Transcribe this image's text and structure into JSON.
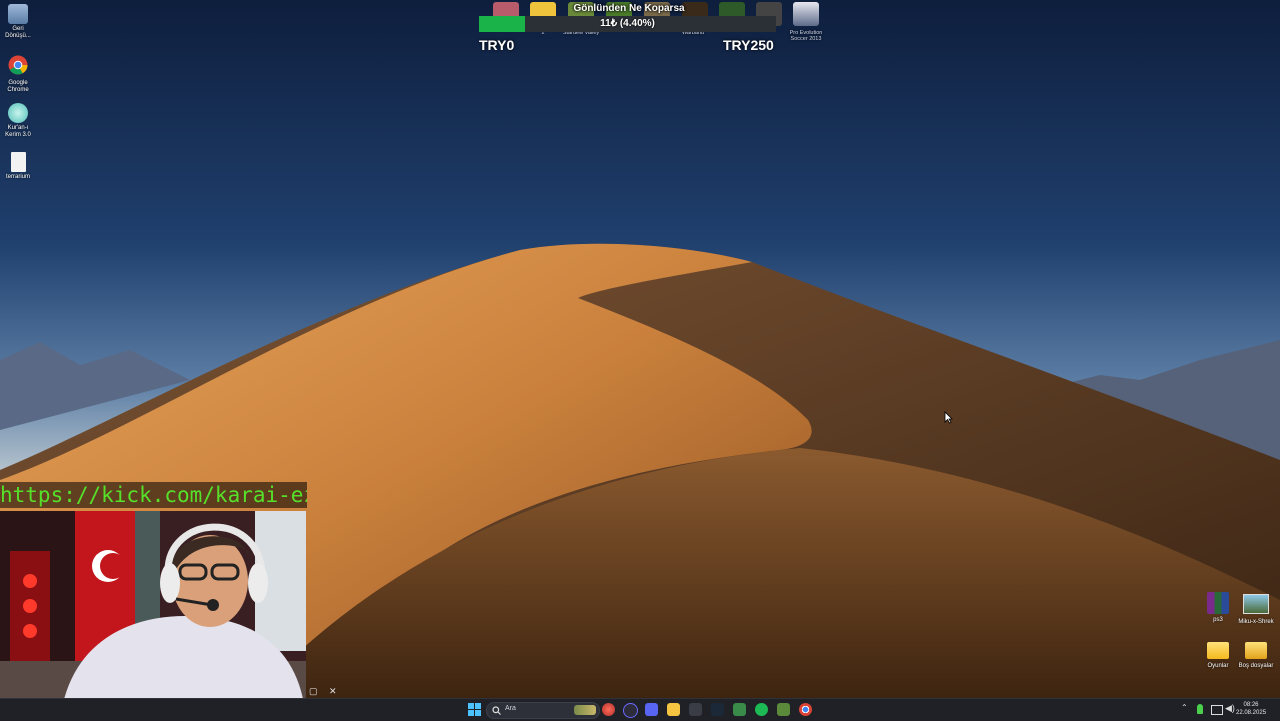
{
  "desktop": {
    "left_icons": [
      {
        "label": "Geri Dönüşü...",
        "icon": "recycle-bin-icon"
      },
      {
        "label": "Google Chrome",
        "icon": "chrome-icon"
      },
      {
        "label": "Kur'an-ı Kerim 3.0",
        "icon": "quran-app-icon"
      },
      {
        "label": "terrarium",
        "icon": "text-file-icon"
      }
    ],
    "right_icons": [
      {
        "label": "ps3",
        "icon": "winrar-archive-icon"
      },
      {
        "label": "Miku-x-Shrek",
        "icon": "image-file-icon"
      },
      {
        "label": "Oyunlar",
        "icon": "folder-icon"
      },
      {
        "label": "Boş dosyalar",
        "icon": "folder-icon"
      }
    ],
    "top_shortcuts": [
      {
        "label": "Pro Evolution Soccer 2013",
        "icon": "pes-2013-icon"
      }
    ]
  },
  "overlay": {
    "song_title": "Gönlünden Ne Koparsa",
    "donation_goal": {
      "amount_text": "11₺ (4.40%)",
      "progress_fraction": 0.044,
      "min_label": "TRY0",
      "max_label": "TRY250",
      "fill_color": "#19b34a"
    },
    "game_captions": [
      "2",
      "Stardew Valley",
      "Warband",
      "Pro Evolution Soccer 2013"
    ],
    "kick_link": "https://kick.com/karai-ez"
  },
  "taskbar": {
    "search_placeholder": "Ara",
    "time": "08:26",
    "date": "22.08.2025",
    "apps": [
      "start-icon",
      "search-icon",
      "chrome-alt-icon",
      "obs-icon",
      "discord-icon",
      "file-explorer-icon",
      "calculator-icon",
      "steam-icon",
      "notepad-icon",
      "spotify-icon",
      "minecraft-icon",
      "chrome-icon"
    ],
    "tray": [
      "chevron-up-icon",
      "location-icon",
      "network-icon",
      "volume-icon"
    ]
  }
}
